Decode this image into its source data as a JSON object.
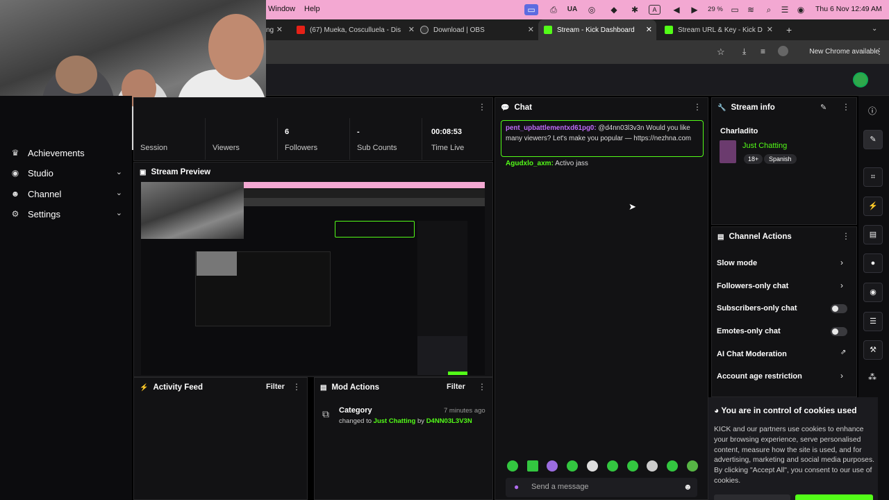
{
  "menubar": {
    "items": [
      "Window",
      "Help"
    ],
    "status_icons": [
      "display-icon",
      "printer-icon",
      "flag-icon",
      "sync-icon",
      "dropbox-icon",
      "bluetooth-icon",
      "language-icon",
      "volume-icon",
      "play-icon",
      "battery-icon",
      "wifi-icon",
      "search-icon",
      "control-center-icon",
      "siri-icon"
    ],
    "keyboard": "UA",
    "input_source": "A",
    "battery": "29 %",
    "datetime": "Thu 6 Nov  12:49 AM"
  },
  "tabs": [
    {
      "label": "ng",
      "favicon": "tab-fragment",
      "active": false
    },
    {
      "label": "(67) Mueka, Cosculluela - Dis",
      "favicon": "youtube-icon",
      "active": false
    },
    {
      "label": "Download | OBS",
      "favicon": "obs-icon",
      "active": false
    },
    {
      "label": "Stream - Kick Dashboard",
      "favicon": "kick-icon",
      "active": true
    },
    {
      "label": "Stream URL & Key - Kick Das",
      "favicon": "kick-icon",
      "active": false
    }
  ],
  "toolbar": {
    "new_chrome": "New Chrome available"
  },
  "sidebar": {
    "items": [
      {
        "label": "Achievements",
        "icon": "trophy-icon",
        "chevron": false
      },
      {
        "label": "Studio",
        "icon": "studio-icon",
        "chevron": true
      },
      {
        "label": "Channel",
        "icon": "users-icon",
        "chevron": true
      },
      {
        "label": "Settings",
        "icon": "gear-icon",
        "chevron": true
      }
    ]
  },
  "stats": [
    {
      "value": "",
      "label": "Session"
    },
    {
      "value": "",
      "label": "Viewers"
    },
    {
      "value": "6",
      "label": "Followers"
    },
    {
      "value": "-",
      "label": "Sub Counts"
    },
    {
      "value": "00:08:53",
      "label": "Time Live"
    }
  ],
  "panels": {
    "preview_title": "Stream Preview",
    "activity_title": "Activity Feed",
    "mod_title": "Mod Actions",
    "chat_title": "Chat",
    "info_title": "Stream info",
    "actions_title": "Channel Actions",
    "filter_label": "Filter"
  },
  "mod_action": {
    "title": "Category",
    "time": "7 minutes ago",
    "prefix": "changed to",
    "category": "Just Chatting",
    "by": "by",
    "user": "D4NN03L3V3N"
  },
  "chat": {
    "messages": [
      {
        "user": "pent_upbattlementxd61pg0:",
        "text": "@d4nn03l3v3n Would you like many viewers? Let's make you popular — https://nezhna.com"
      },
      {
        "user": "Agudxlo_axm:",
        "text": "Activo jass"
      }
    ],
    "placeholder": "Send a message"
  },
  "stream_info": {
    "channel": "Charladito",
    "category": "Just Chatting",
    "tags": [
      "18+",
      "Spanish"
    ]
  },
  "channel_actions": [
    {
      "label": "Slow mode",
      "control": "arrow"
    },
    {
      "label": "Followers-only chat",
      "control": "arrow"
    },
    {
      "label": "Subscribers-only chat",
      "control": "toggle"
    },
    {
      "label": "Emotes-only chat",
      "control": "toggle"
    },
    {
      "label": "AI Chat Moderation",
      "control": "external"
    },
    {
      "label": "Account age restriction",
      "control": "arrow"
    }
  ],
  "cookie": {
    "title": "You are in control of cookies used",
    "body": "KICK and our partners use cookies to enhance your browsing experience, serve personalised content, measure how the site is used, and for advertising, marketing and social media purposes. By clicking \"Accept All\", you consent to our use of cookies."
  },
  "rail_icons": [
    "info-icon",
    "edit-icon",
    "screenshot-icon",
    "lightning-icon",
    "clipboard-icon",
    "chat-bubble-icon",
    "broadcast-icon",
    "layout-icon",
    "wrench-icon",
    "apps-icon"
  ],
  "colors": {
    "accent": "#53fc18",
    "username_purple": "#c06cfa",
    "menubar_bg": "#f3a8d2"
  }
}
